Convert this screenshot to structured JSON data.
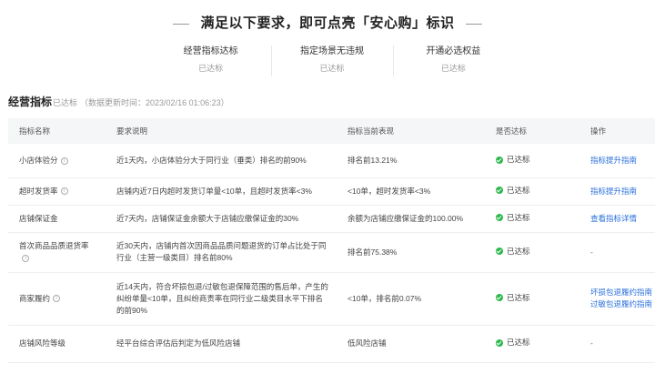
{
  "banner": {
    "title": "满足以下要求，即可点亮「安心购」标识",
    "requirements": [
      {
        "name": "经营指标达标",
        "status": "已达标"
      },
      {
        "name": "指定场景无违规",
        "status": "已达标"
      },
      {
        "name": "开通必选权益",
        "status": "已达标"
      }
    ]
  },
  "section": {
    "title": "经营指标",
    "badge": "已达标",
    "update_time": "（数据更新时间：2023/02/16 01:06:23）"
  },
  "table": {
    "headers": {
      "name": "指标名称",
      "requirement": "要求说明",
      "current": "指标当前表现",
      "reached": "是否达标",
      "action": "操作"
    },
    "rows": [
      {
        "name": "小店体验分",
        "requirement": "近1天内，小店体验分大于同行业（垂类）排名的前90%",
        "current": "排名前13.21%",
        "reached": "已达标",
        "actions": [
          "指标提升指南"
        ]
      },
      {
        "name": "超时发货率",
        "requirement": "店铺内近7日内超时发货订单量<10单，且超时发货率<3%",
        "current": "<10单，超时发货率<3%",
        "reached": "已达标",
        "actions": [
          "指标提升指南"
        ]
      },
      {
        "name": "店铺保证金",
        "requirement": "近7天内，店铺保证金余额大于店铺应缴保证金的30%",
        "current": "余额为店铺应缴保证金的100.00%",
        "reached": "已达标",
        "actions": [
          "查看指标详情"
        ]
      },
      {
        "name": "首次商品品质退货率",
        "requirement": "近30天内，店铺内首次因商品品质问题退货的订单占比处于同行业（主营一级类目）排名前80%",
        "current": "排名前75.38%",
        "reached": "已达标",
        "actions": [],
        "dash": "-"
      },
      {
        "name": "商家履约",
        "requirement": "近14天内，符合坏损包退/过敏包退保障范围的售后单，产生的纠纷单量<10单，且纠纷商责率在同行业二级类目水平下排名的前90%",
        "current": "<10单，排名前0.07%",
        "reached": "已达标",
        "actions": [
          "坏损包退履约指南",
          "过敏包退履约指南"
        ]
      },
      {
        "name": "店铺风险等级",
        "requirement": "经平台综合评估后判定为低风险店铺",
        "current": "低风险店铺",
        "reached": "已达标",
        "actions": [],
        "dash": "-"
      }
    ]
  },
  "colors": {
    "success": "#2db84d",
    "link": "#2a6fdb"
  }
}
